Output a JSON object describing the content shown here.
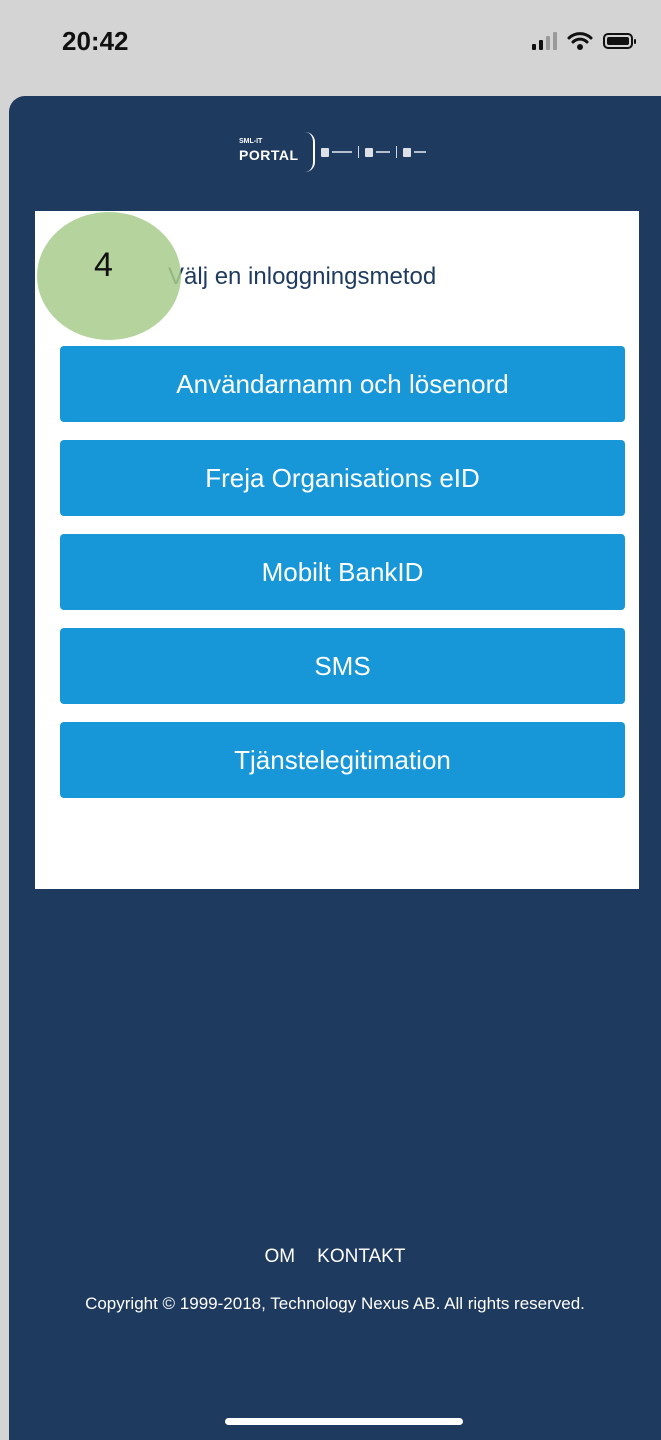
{
  "status_bar": {
    "time": "20:42",
    "icons": [
      "signal-icon",
      "wifi-icon",
      "battery-icon"
    ]
  },
  "header": {
    "logo_sub": "SML-IT",
    "logo_main": "PORTAL"
  },
  "card": {
    "title": "Välj en inloggningsmetod",
    "step_badge": "4",
    "methods": [
      "Användarnamn och lösenord",
      "Freja Organisations eID",
      "Mobilt BankID",
      "SMS",
      "Tjänstelegitimation"
    ]
  },
  "footer": {
    "links": [
      "OM",
      "KONTAKT"
    ],
    "copyright": "Copyright © 1999-2018, Technology Nexus AB. All rights reserved."
  },
  "colors": {
    "background": "#1e3a5f",
    "button": "#1797d8",
    "badge": "#a8cc8c"
  }
}
